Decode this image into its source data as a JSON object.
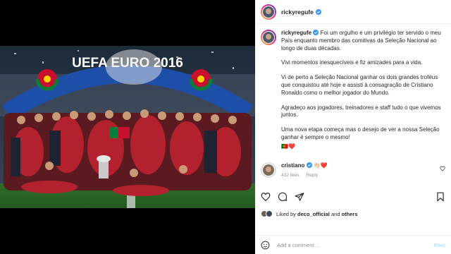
{
  "photo": {
    "banner_text": "UEFA EURO 2016"
  },
  "header": {
    "username": "rickyregufe"
  },
  "caption": {
    "username": "rickyregufe",
    "paragraphs": [
      "Foi um orgulho e um privilégio ter servido o meu País enquanto membro das comitivas da Seleção Nacional ao longo de duas décadas.",
      "Vivi momentos inesquecíveis e fiz amizades para a vida.",
      "Vi de perto a Seleção Nacional ganhar os dois grandes troféus que conquistou até hoje e assisti à consagração de Cristiano Ronaldo como o melhor jogador do Mundo.",
      "Agradeço aos jogadores, treinadores e staff tudo o que vivemos juntos.",
      "Uma nova etapa começa mas o desejo de ver a nossa Seleção ganhar é sempre o mesmo!",
      "🇵🇹❤️"
    ]
  },
  "comment": {
    "username": "cristiano",
    "text": "👏🏻❤️",
    "likes": "432 likes",
    "reply": "Reply"
  },
  "liked_by": {
    "prefix": "Liked by",
    "user": "deco_official",
    "and": "and",
    "others": "others"
  },
  "add_comment": {
    "placeholder": "Add a comment…",
    "post_label": "Post"
  },
  "colors": {
    "verified": "#3897f0",
    "post_disabled": "#b2dffc",
    "secondary_text": "#8e8e8e"
  }
}
